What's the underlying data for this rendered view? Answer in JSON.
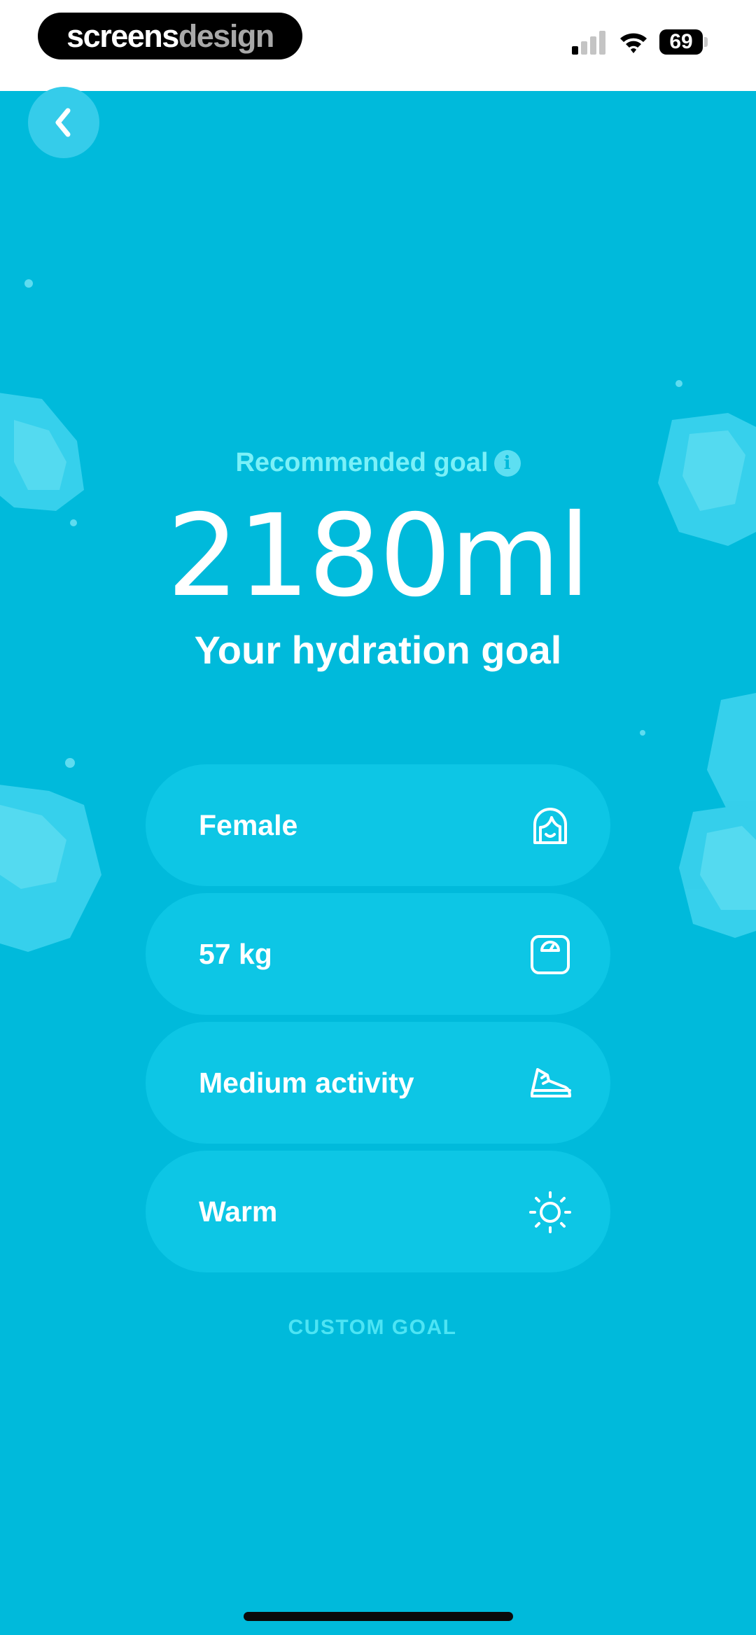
{
  "status_bar": {
    "brand_part1": "screens",
    "brand_part2": "design",
    "battery": "69"
  },
  "header": {
    "back_icon": "chevron-left-icon"
  },
  "goal": {
    "label": "Recommended goal",
    "info_icon": "i",
    "amount": "2180ml",
    "title": "Your hydration goal"
  },
  "options": [
    {
      "label": "Female",
      "icon": "female-face-icon"
    },
    {
      "label": "57 kg",
      "icon": "scale-icon"
    },
    {
      "label": "Medium activity",
      "icon": "sneaker-icon"
    },
    {
      "label": "Warm",
      "icon": "sun-icon"
    }
  ],
  "custom_goal": "CUSTOM GOAL",
  "colors": {
    "background": "#00BADB",
    "pill": "#0DC6E5",
    "accent_text": "#7AF0F8",
    "white": "#FFFFFF"
  }
}
